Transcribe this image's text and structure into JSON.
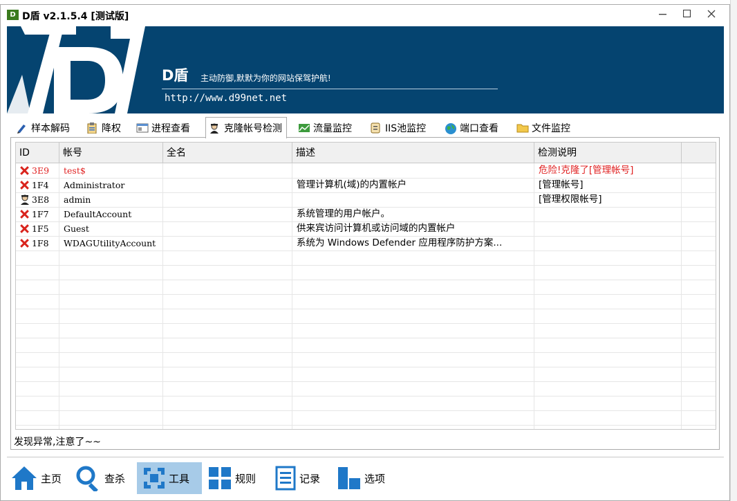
{
  "window": {
    "title": "D盾 v2.1.5.4 [测试版]",
    "icon_text": "D"
  },
  "banner": {
    "brand": "D盾",
    "slogan": "主动防御,默默为你的网站保驾护航!",
    "url": "http://www.d99net.net"
  },
  "tabs": [
    {
      "label": "样本解码",
      "icon": "pen-icon"
    },
    {
      "label": "降权",
      "icon": "clipboard-icon"
    },
    {
      "label": "进程查看",
      "icon": "window-icon"
    },
    {
      "label": "克隆帐号检测",
      "icon": "spy-icon",
      "active": true
    },
    {
      "label": "流量监控",
      "icon": "chart-icon"
    },
    {
      "label": "IIS池监控",
      "icon": "scroll-icon"
    },
    {
      "label": "端口查看",
      "icon": "globe-icon"
    },
    {
      "label": "文件监控",
      "icon": "folder-icon"
    }
  ],
  "table": {
    "columns": [
      "ID",
      "帐号",
      "全名",
      "描述",
      "检测说明"
    ],
    "rows": [
      {
        "status": "x",
        "id": "3E9",
        "account": "test$",
        "fullname": "",
        "desc": "",
        "note": "危险!克隆了[管理帐号]",
        "danger": true
      },
      {
        "status": "x",
        "id": "1F4",
        "account": "Administrator",
        "fullname": "",
        "desc": "管理计算机(域)的内置帐户",
        "note": "[管理帐号]"
      },
      {
        "status": "user",
        "id": "3E8",
        "account": "admin",
        "fullname": "",
        "desc": "",
        "note": "[管理权限帐号]"
      },
      {
        "status": "x",
        "id": "1F7",
        "account": "DefaultAccount",
        "fullname": "",
        "desc": "系统管理的用户帐户。",
        "note": ""
      },
      {
        "status": "x",
        "id": "1F5",
        "account": "Guest",
        "fullname": "",
        "desc": "供来宾访问计算机或访问域的内置帐户",
        "note": ""
      },
      {
        "status": "x",
        "id": "1F8",
        "account": "WDAGUtilityAccount",
        "fullname": "",
        "desc": "系统为 Windows Defender 应用程序防护方案...",
        "note": ""
      }
    ]
  },
  "status_text": "发现异常,注意了~~",
  "bottom_nav": [
    {
      "label": "主页",
      "icon": "home-icon"
    },
    {
      "label": "查杀",
      "icon": "search-icon"
    },
    {
      "label": "工具",
      "icon": "tools-icon",
      "active": true
    },
    {
      "label": "规则",
      "icon": "grid-icon"
    },
    {
      "label": "记录",
      "icon": "document-icon"
    },
    {
      "label": "选项",
      "icon": "options-icon"
    }
  ],
  "colors": {
    "banner_bg": "#054470",
    "danger": "#e02020",
    "nav_active": "#a7cbe8"
  }
}
